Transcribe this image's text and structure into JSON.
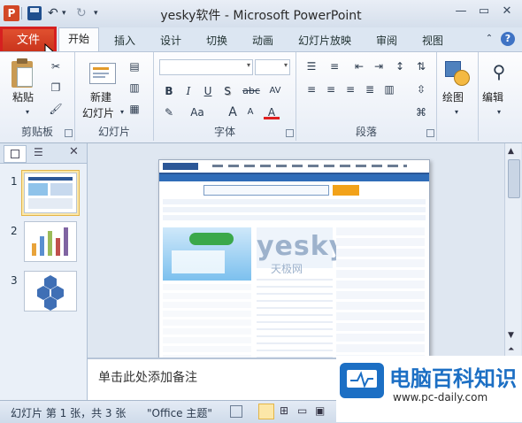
{
  "window": {
    "title": "yesky软件 - Microsoft PowerPoint"
  },
  "tabs": {
    "file": "文件",
    "home": "开始",
    "insert": "插入",
    "design": "设计",
    "transitions": "切换",
    "animations": "动画",
    "slideshow": "幻灯片放映",
    "review": "审阅",
    "view": "视图"
  },
  "ribbon": {
    "clipboard": {
      "paste": "粘贴",
      "group": "剪贴板"
    },
    "slides": {
      "new_slide_1": "新建",
      "new_slide_2": "幻灯片",
      "group": "幻灯片"
    },
    "font": {
      "group": "字体",
      "bold": "B",
      "italic": "I",
      "underline": "U",
      "strike": "S",
      "abc": "abc",
      "spacing": "AV",
      "case": "Aa",
      "grow": "A",
      "shrink": "A",
      "color": "A"
    },
    "paragraph": {
      "group": "段落"
    },
    "drawing": {
      "label": "绘图"
    },
    "editing": {
      "label": "编辑"
    }
  },
  "slides_pane": {
    "numbers": [
      "1",
      "2",
      "3"
    ]
  },
  "slide_content": {
    "brand": "yesky",
    "subtitle": "天极网"
  },
  "notes": {
    "placeholder": "单击此处添加备注"
  },
  "statusbar": {
    "slide_info": "幻灯片 第 1 张，共 3 张",
    "theme": "\"Office 主题\""
  },
  "watermark": {
    "name": "电脑百科知识",
    "url": "www.pc-daily.com"
  },
  "colors": {
    "file_tab": "#d2391f",
    "highlight_box": "#d62020",
    "accent": "#2b5797"
  }
}
